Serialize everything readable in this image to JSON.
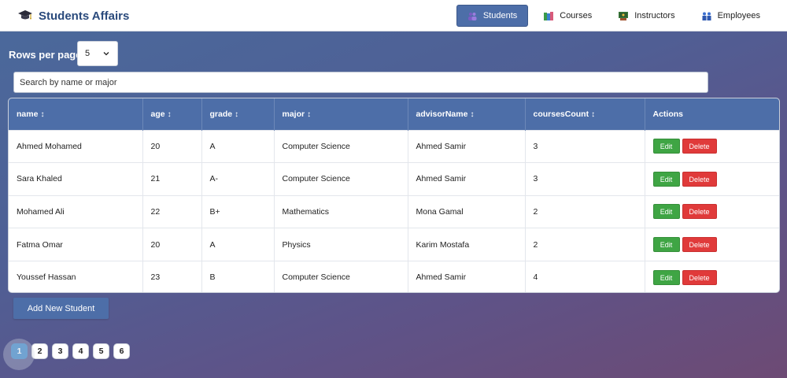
{
  "brand": {
    "title": "Students Affairs",
    "icon": "graduation-cap-icon"
  },
  "nav": [
    {
      "label": "Students",
      "icon": "students-icon",
      "active": true
    },
    {
      "label": "Courses",
      "icon": "books-icon",
      "active": false
    },
    {
      "label": "Instructors",
      "icon": "instructor-icon",
      "active": false
    },
    {
      "label": "Employees",
      "icon": "employees-icon",
      "active": false
    }
  ],
  "rows_per_page": {
    "label": "Rows per page:",
    "value": "5"
  },
  "search": {
    "placeholder": "Search by name or major",
    "value": ""
  },
  "table": {
    "columns": [
      "name",
      "age",
      "grade",
      "major",
      "advisorName",
      "coursesCount",
      "Actions"
    ],
    "sort_symbol": "↕",
    "rows": [
      [
        "Ahmed Mohamed",
        "20",
        "A",
        "Computer Science",
        "Ahmed Samir",
        "3"
      ],
      [
        "Sara Khaled",
        "21",
        "A-",
        "Computer Science",
        "Ahmed Samir",
        "3"
      ],
      [
        "Mohamed Ali",
        "22",
        "B+",
        "Mathematics",
        "Mona Gamal",
        "2"
      ],
      [
        "Fatma Omar",
        "20",
        "A",
        "Physics",
        "Karim Mostafa",
        "2"
      ],
      [
        "Youssef Hassan",
        "23",
        "B",
        "Computer Science",
        "Ahmed Samir",
        "4"
      ]
    ],
    "edit_label": "Edit",
    "delete_label": "Delete"
  },
  "add_button": {
    "label": "Add New Student"
  },
  "pagination": {
    "pages": [
      "1",
      "2",
      "3",
      "4",
      "5",
      "6"
    ],
    "current": "1"
  },
  "colors": {
    "primary": "#4d6ea8",
    "edit": "#3fa544",
    "delete": "#e03a3a",
    "active_page": "#3e88c8"
  }
}
